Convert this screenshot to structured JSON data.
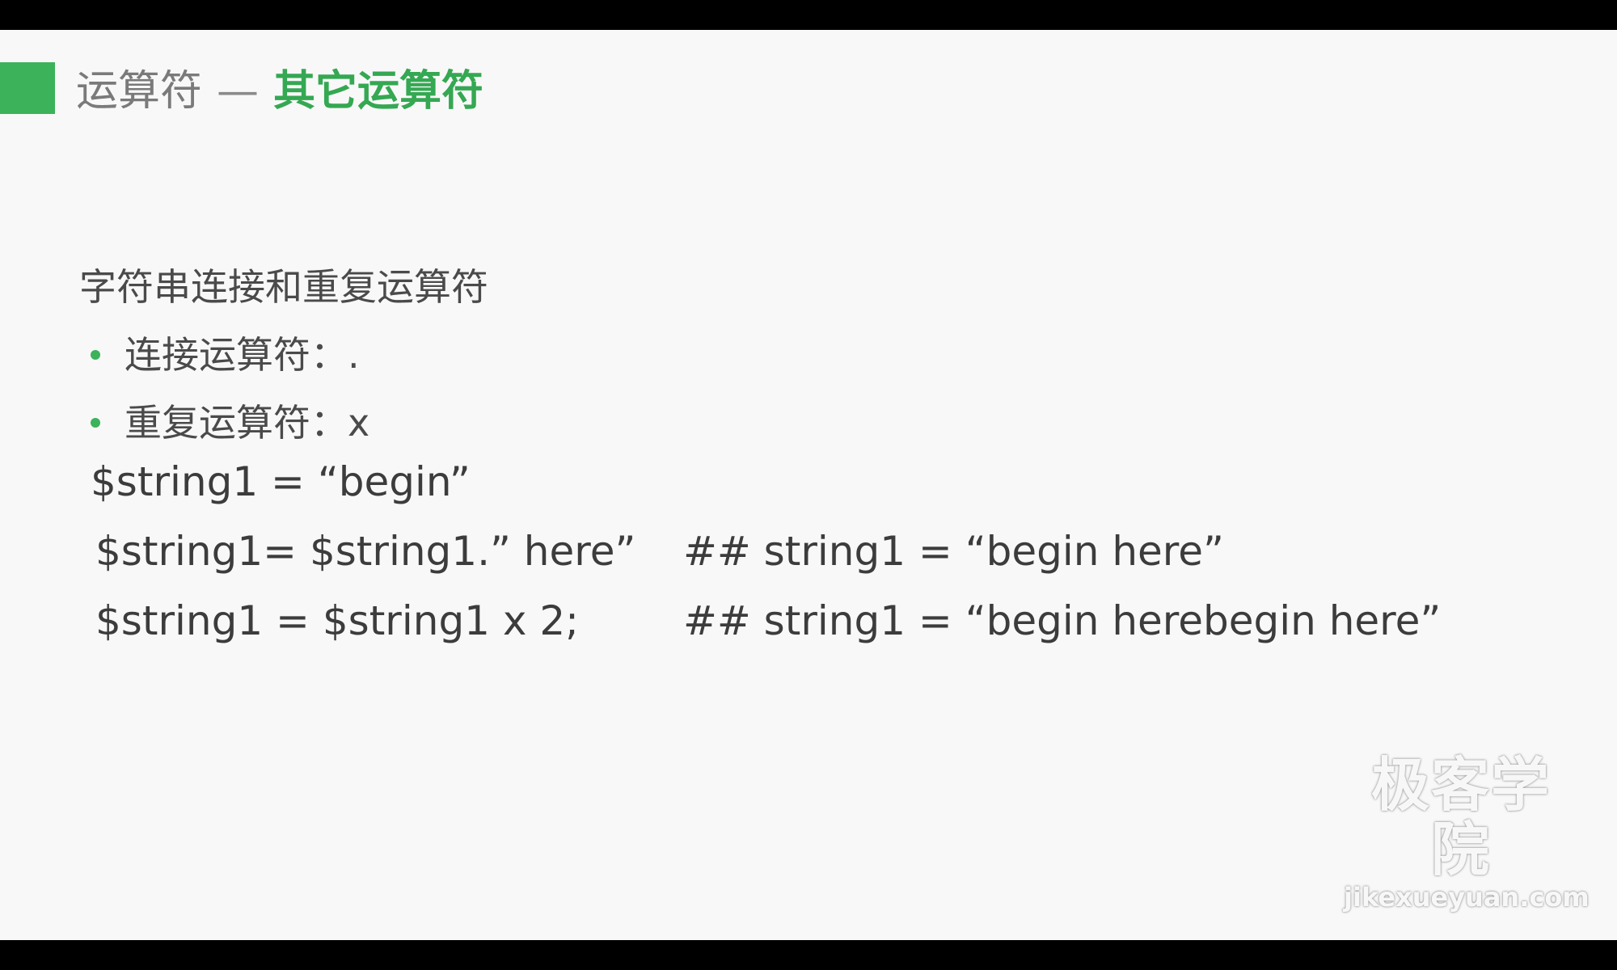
{
  "slide": {
    "title": {
      "prefix": "运算符",
      "separator": "—",
      "main": "其它运算符"
    },
    "heading": "字符串连接和重复运算符",
    "bullets": [
      {
        "text": "连接运算符：."
      },
      {
        "text": "重复运算符：x"
      }
    ],
    "code_lines": [
      {
        "code": "$string1 = “begin”",
        "comment": ""
      },
      {
        "code": "$string1= $string1.” here”",
        "comment": "## string1 = “begin here”"
      },
      {
        "code": "$string1 = $string1 x 2;",
        "comment": "## string1 = “begin herebegin here”"
      }
    ],
    "watermark": {
      "cn": "极客学院",
      "en": "jikexueyuan.com"
    }
  },
  "colors": {
    "accent_green": "#3cb25a",
    "background": "#f8f8f8",
    "text": "#4a4a4a"
  }
}
